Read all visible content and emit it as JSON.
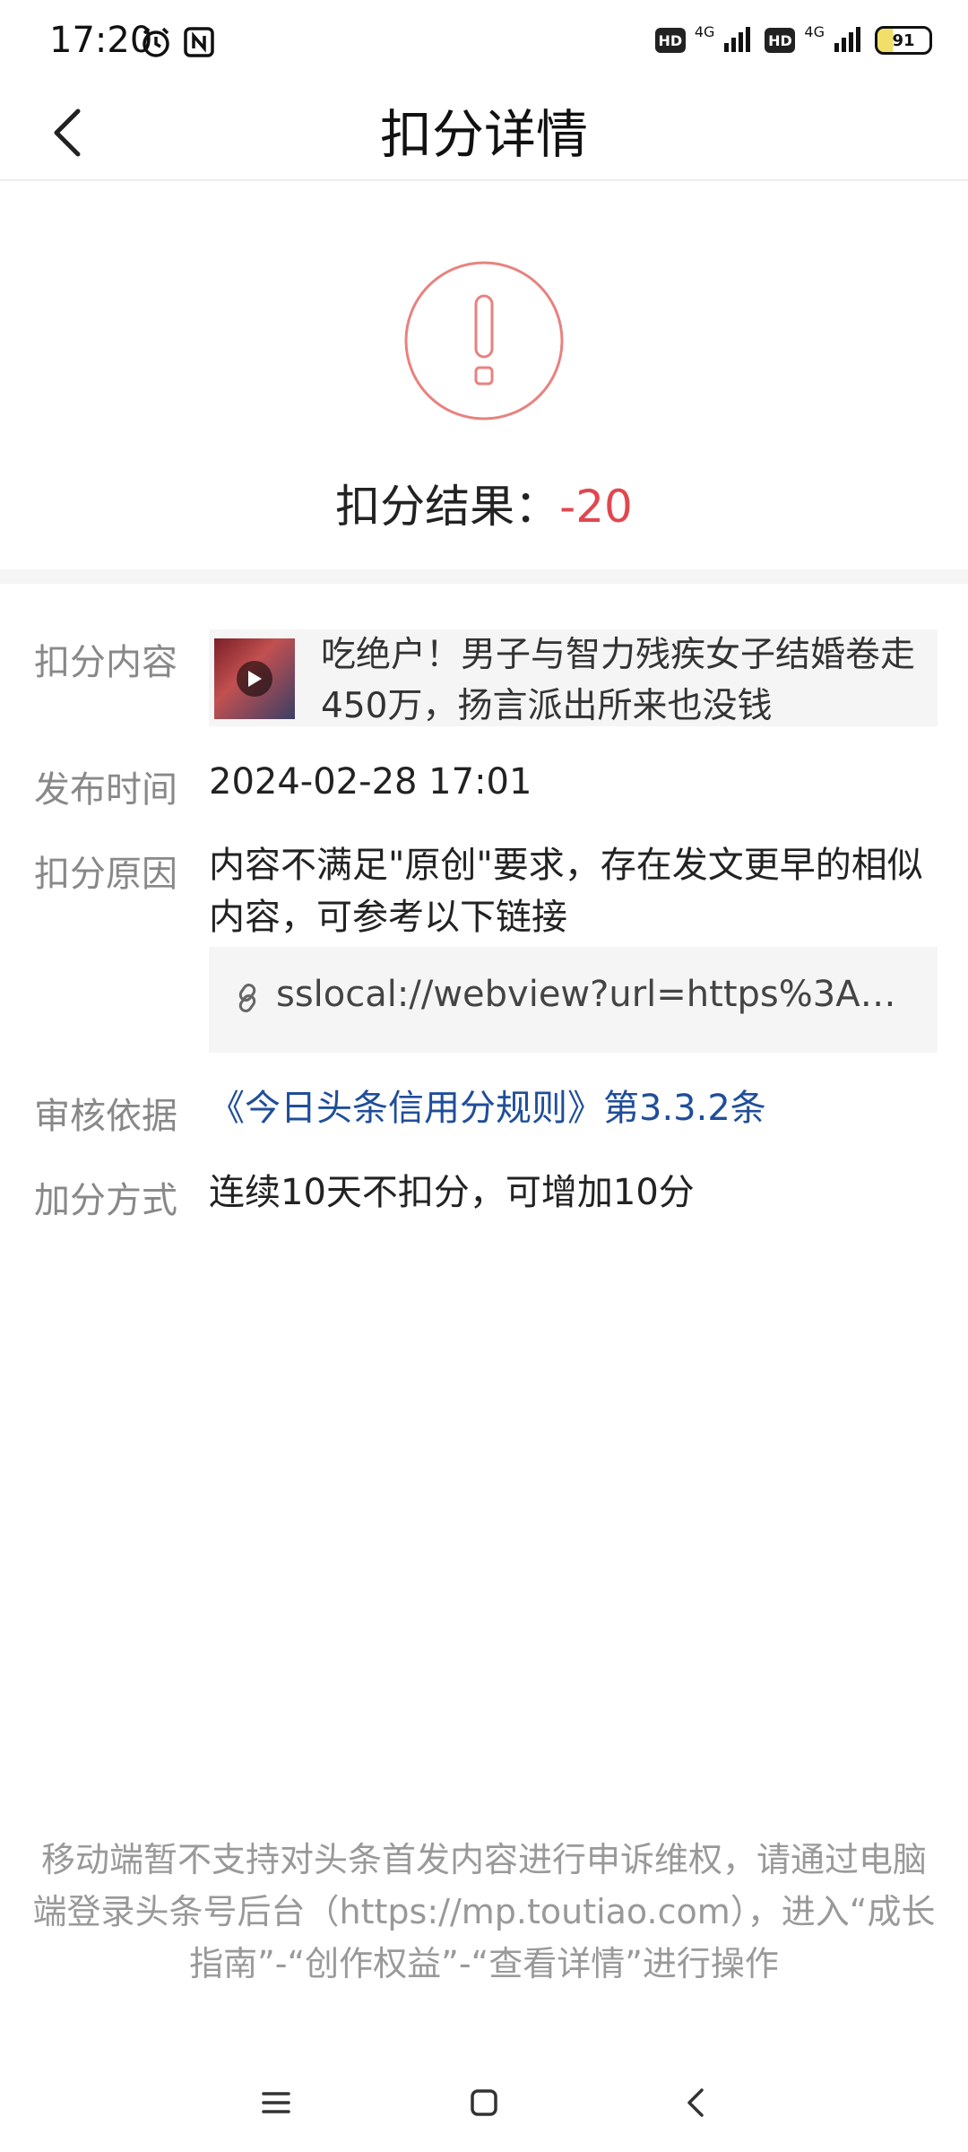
{
  "status_bar": {
    "time": "17:20",
    "net1": "4G",
    "net2": "4G",
    "hd": "HD",
    "battery": "91"
  },
  "nav": {
    "title": "扣分详情"
  },
  "result": {
    "label": "扣分结果：",
    "value": "-20",
    "accent_color": "#e1474f"
  },
  "details": {
    "content_label": "扣分内容",
    "content_title": "吃绝户！男子与智力残疾女子结婚卷走450万，扬言派出所来也没钱",
    "publish_label": "发布时间",
    "publish_time": "2024-02-28 17:01",
    "reason_label": "扣分原因",
    "reason_text": "内容不满足\"原创\"要求，存在发文更早的相似内容，可参考以下链接",
    "reason_link": "sslocal://webview?url=https%3A%2...",
    "basis_label": "审核依据",
    "basis_text": "《今日头条信用分规则》第3.3.2条",
    "bonus_label": "加分方式",
    "bonus_text": "连续10天不扣分，可增加10分"
  },
  "footer": {
    "note": "移动端暂不支持对头条首发内容进行申诉维权，请通过电脑端登录头条号后台（https://mp.toutiao.com），进入“成长指南”-“创作权益”-“查看详情”进行操作"
  }
}
